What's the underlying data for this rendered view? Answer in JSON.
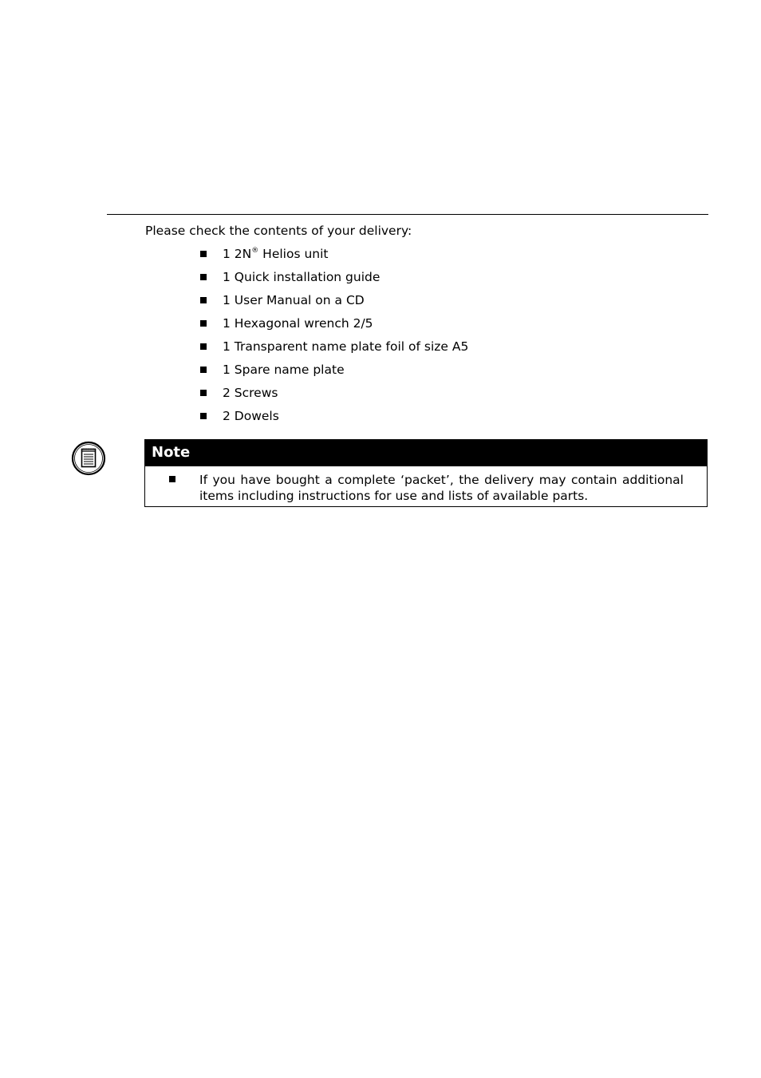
{
  "document": {
    "intro": "Please check the contents of your delivery:",
    "items": [
      {
        "text": "1 2N",
        "superscript": "®",
        "suffix": " Helios unit"
      },
      {
        "text": "1 Quick installation guide"
      },
      {
        "text": "1 User Manual on a CD"
      },
      {
        "text": "1 Hexagonal wrench 2/5"
      },
      {
        "text": "1 Transparent name plate foil of size A5"
      },
      {
        "text": "1 Spare name plate"
      },
      {
        "text": "2 Screws"
      },
      {
        "text": "2 Dowels"
      }
    ],
    "note": {
      "icon": "notepad-icon",
      "title": "Note",
      "text": "If you have bought a complete ‘packet’, the delivery may contain additional items including instructions for use and lists of available parts."
    }
  }
}
